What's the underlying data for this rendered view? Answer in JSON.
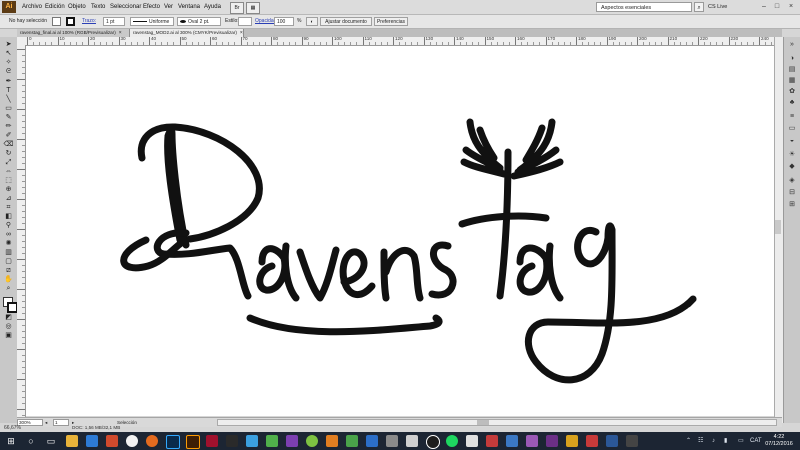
{
  "menu": {
    "items": [
      "Archivo",
      "Edición",
      "Objeto",
      "Texto",
      "Seleccionar",
      "Efecto",
      "Ver",
      "Ventana",
      "Ayuda"
    ],
    "workspace": "Aspectos esenciales",
    "cs_live": "CS Live"
  },
  "control": {
    "no_selection": "No hay selección",
    "stroke_label": "Trazo:",
    "stroke_weight": "1 pt",
    "profile": "Uniforme",
    "brush": "Oval 2 pt.",
    "style_label": "Estilo:",
    "opacity_label": "Opacidad:",
    "opacity_value": "100",
    "opacity_unit": "%",
    "fit_document": "Ajustar documento",
    "preferences": "Preferencias"
  },
  "tabs": [
    {
      "label": "ravenstag_final.ai al 100% (RGB/Previsualizar)",
      "close": "×"
    },
    {
      "label": "ravenstag_MOD2.ai al 300% (CMYK/Previsualizar)",
      "close": "×"
    }
  ],
  "ruler": {
    "top": [
      "0",
      "10",
      "20",
      "30",
      "40",
      "50",
      "60",
      "70",
      "80",
      "90",
      "100",
      "110",
      "120",
      "130",
      "140",
      "150",
      "160",
      "170",
      "180",
      "190",
      "200",
      "210",
      "220",
      "230",
      "240"
    ]
  },
  "status": {
    "zoom": "300%",
    "artboard": "1",
    "mode": "Selección",
    "doc_info": "DOC: 1,56 MB/32,1 MB",
    "zoom_readout": "66,67%"
  },
  "taskbar": {
    "language": "CAT",
    "time": "4:22",
    "date": "07/12/2016"
  },
  "colors": {
    "taskbar": "#1c2533",
    "ui_gray": "#d6d6d6",
    "canvas": "#ffffff",
    "artwork": "#111111"
  },
  "artwork": {
    "description_icon": "ravenstag-lettering"
  }
}
